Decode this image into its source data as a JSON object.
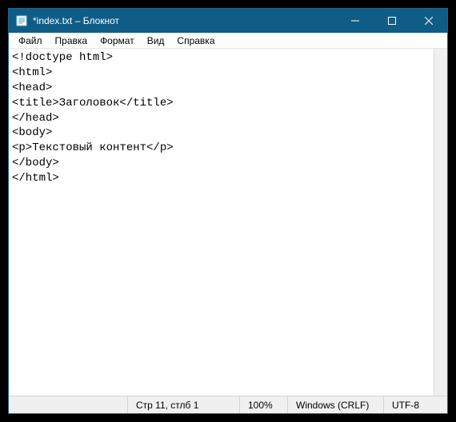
{
  "window": {
    "title": "*index.txt – Блокнот"
  },
  "menu": {
    "file": "Файл",
    "edit": "Правка",
    "format": "Формат",
    "view": "Вид",
    "help": "Справка"
  },
  "content": {
    "text": "<!doctype html>\n<html>\n<head>\n<title>Заголовок</title>\n</head>\n<body>\n<p>Текстовый контент</p>\n</body>\n</html>"
  },
  "status": {
    "cursor": "Стр 11, стлб 1",
    "zoom": "100%",
    "eol": "Windows (CRLF)",
    "encoding": "UTF-8"
  }
}
